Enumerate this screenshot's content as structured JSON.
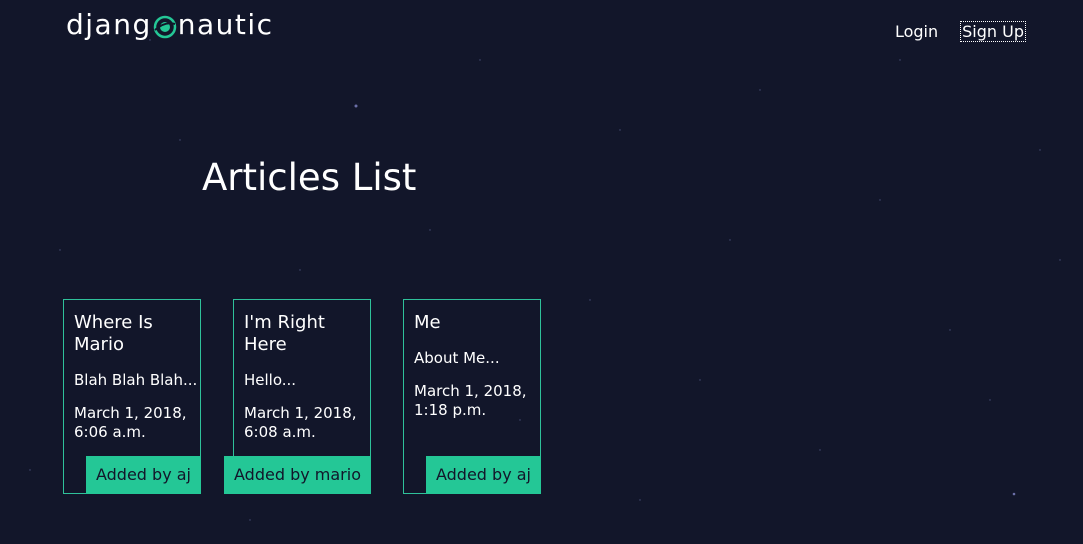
{
  "header": {
    "logo_left": "djang",
    "logo_right": "nautic",
    "nav": [
      {
        "label": "Login"
      },
      {
        "label": "Sign Up"
      }
    ]
  },
  "main": {
    "title": "Articles List",
    "articles": [
      {
        "title": "Where Is Mario",
        "snippet": "Blah Blah Blah...",
        "date": "March 1, 2018, 6:06 a.m.",
        "author": "Added by aj"
      },
      {
        "title": "I'm Right Here",
        "snippet": "Hello...",
        "date": "March 1, 2018, 6:08 a.m.",
        "author": "Added by mario"
      },
      {
        "title": "Me",
        "snippet": "About Me...",
        "date": "March 1, 2018, 1:18 p.m.",
        "author": "Added by aj"
      }
    ]
  },
  "colors": {
    "background": "#12162a",
    "accent": "#24c796",
    "card_border": "#2fc19a"
  }
}
